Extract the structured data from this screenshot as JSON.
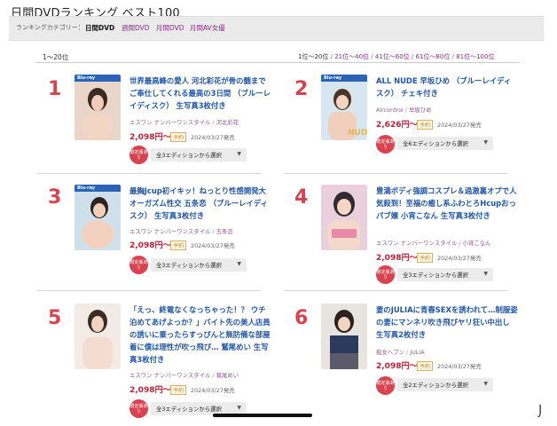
{
  "page_title": "日間DVDランキング ベスト100",
  "category_bar": {
    "label": "ランキングカテゴリー：",
    "links": [
      {
        "label": "日間DVD",
        "active": true
      },
      {
        "label": "週間DVD",
        "active": false
      },
      {
        "label": "月間DVD",
        "active": false
      },
      {
        "label": "月間AV女優",
        "active": false
      }
    ]
  },
  "range_label": "1〜20位",
  "pager": {
    "current": "1位〜20位",
    "links": [
      "21位〜40位",
      "41位〜60位",
      "61位〜80位",
      "81位〜100位"
    ],
    "separator": "/"
  },
  "items": [
    {
      "rank": "1",
      "title": "世界最高峰の愛人 河北彩花が骨の髄までご奉仕してくれる最高の3日間 （ブルーレイディスク） 生写真3枚付き",
      "maker": "エスワン ナンバーワンスタイル",
      "actress": "河北彩花",
      "price": "2,098円〜",
      "reserve_label": "予約",
      "release": "2024/03/27発売",
      "badge": "限定版あり",
      "edition_select": "全3エディションから選択"
    },
    {
      "rank": "2",
      "title": "ALL NUDE 早坂ひめ （ブルーレイディスク） チェキ付き",
      "maker": "Aircontrol",
      "actress": "早坂ひめ",
      "price": "2,626円〜",
      "reserve_label": "予約",
      "release": "2024/03/27発売",
      "badge": "限定版あり",
      "edition_select": "全6エディションから選択"
    },
    {
      "rank": "3",
      "title": "最胸Jcup初イキッ！ねっとり性感開発大オーガズム性交 五条恋 （ブルーレイディスク） 生写真3枚付き",
      "maker": "エスワン ナンバーワンスタイル",
      "actress": "五条恋",
      "price": "2,098円〜",
      "reserve_label": "予約",
      "release": "2024/03/27発売",
      "badge": "限定版あり",
      "edition_select": "全3エディションから選択"
    },
    {
      "rank": "4",
      "title": "豊満ボディ強調コスプレ＆過激裏オプで人気殺到！至福の癒し系ふわとろHcupおっパブ嬢 小宵こなん 生写真3枚付き",
      "maker": "エスワン ナンバーワンスタイル",
      "actress": "小宵こなん",
      "price": "2,098円〜",
      "reserve_label": "予約",
      "release": "2024/03/27発売",
      "badge": "限定版あり",
      "edition_select": "全3エディションから選択"
    },
    {
      "rank": "5",
      "title": "「えっ、終電なくなっちゃった！？ ウチ泊めてあげよっか？」バイト先の美人店員の誘いに乗ったらすっぴんと無防備な部屋着に僕は理性が吹っ飛び… 鷲尾めい 生写真3枚付き",
      "maker": "エスワン ナンバーワンスタイル",
      "actress": "鷲尾めい",
      "price": "2,098円〜",
      "reserve_label": "予約",
      "release": "2024/03/27発売",
      "badge": "限定版あり",
      "edition_select": "全3エディションから選択"
    },
    {
      "rank": "6",
      "title": "妻のJULIAに青春SEXを誘われて…制服姿の妻にマンネリ吹き飛びヤリ狂い中出し 生写真2枚付き",
      "maker": "痴女ヘブン",
      "actress": "JULIA",
      "price": "2,098円〜",
      "reserve_label": "予約",
      "release": "2024/03/27発売",
      "badge": "限定版あり",
      "edition_select": "全2エディションから選択"
    }
  ],
  "colors": {
    "rank": "#d8434f",
    "title_link": "#2056a8",
    "price": "#c0203a",
    "maker": "#8a5a8a",
    "category_link": "#8a2a8a",
    "badge": "#d8434f"
  },
  "icons": {
    "select_caret": "chevron-down-icon",
    "product_image": "product-thumbnail"
  }
}
